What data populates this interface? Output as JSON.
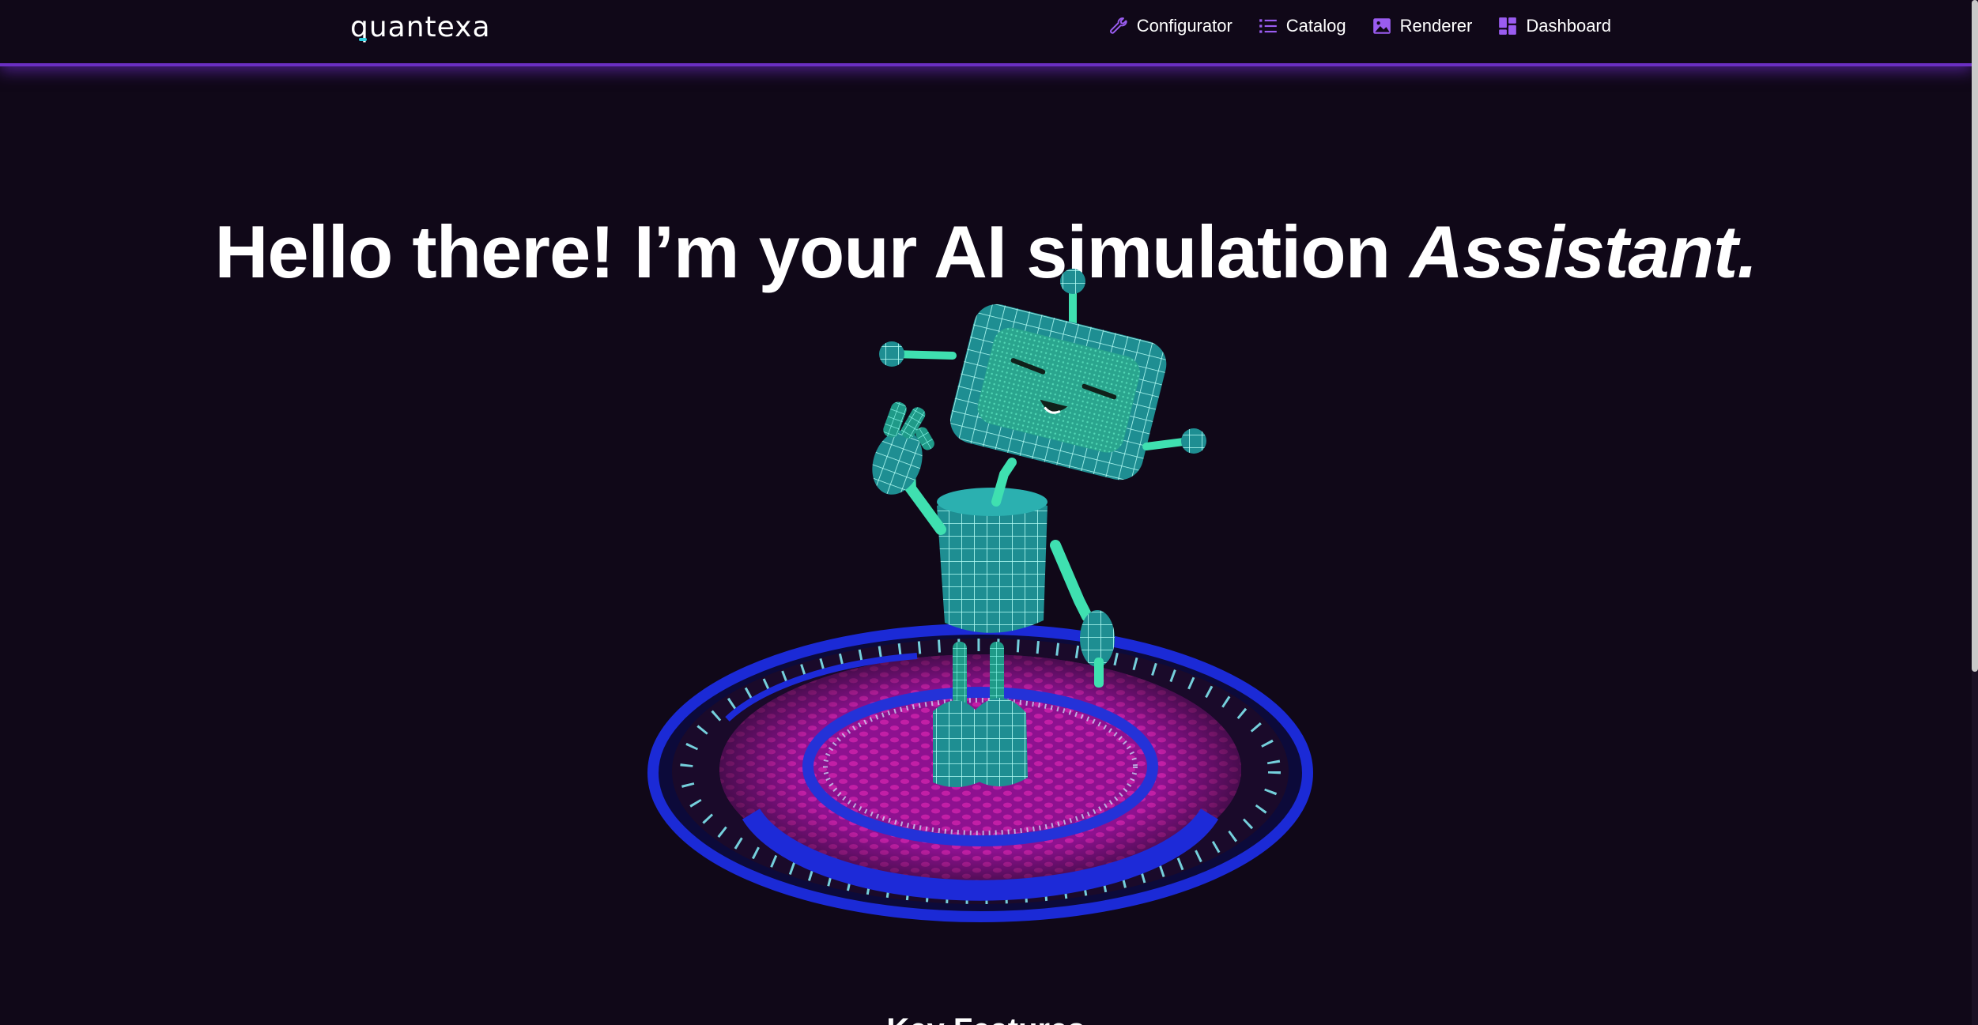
{
  "app": {
    "logo_text": "quantexa"
  },
  "nav": {
    "items": [
      {
        "label": "Configurator",
        "icon": "wrench-icon"
      },
      {
        "label": "Catalog",
        "icon": "list-icon"
      },
      {
        "label": "Renderer",
        "icon": "image-icon"
      },
      {
        "label": "Dashboard",
        "icon": "grid-icon"
      }
    ]
  },
  "hero": {
    "title_main": "Hello there! I’m your AI simulation ",
    "title_emphasis": "Assistant."
  },
  "sections": {
    "features_heading": "Key Features"
  },
  "colors": {
    "background": "#100818",
    "accent_purple": "#7b3fe4",
    "robot_teal": "#2fd0c0",
    "platform_blue": "#1d2ad8",
    "platform_magenta": "#b0189c"
  }
}
